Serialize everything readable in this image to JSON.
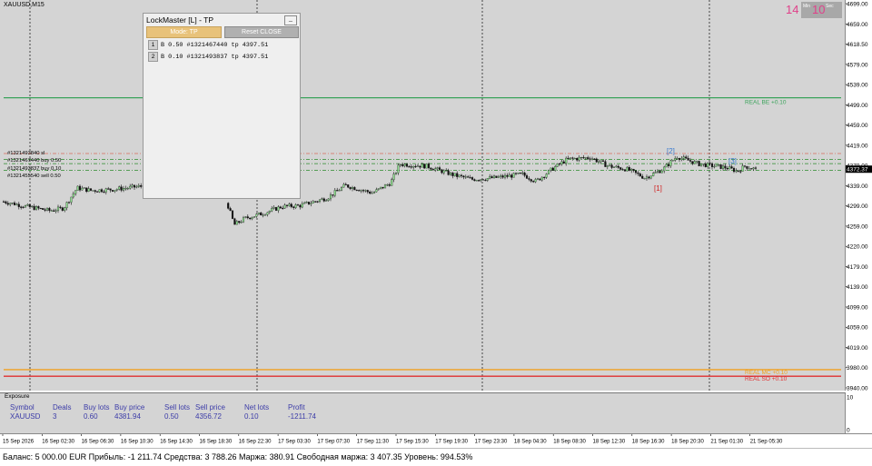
{
  "chart": {
    "symbol_label": "XAUUSD,M15",
    "price_labels": [
      "4699.00",
      "4659.00",
      "4618.50",
      "4579.00",
      "4539.00",
      "4499.00",
      "4459.00",
      "4419.00",
      "4379.00",
      "4339.00",
      "4299.00",
      "4259.00",
      "4220.00",
      "4179.00",
      "4139.00",
      "4099.00",
      "4059.00",
      "4019.00",
      "3980.00",
      "3940.00"
    ],
    "current_price": "4372.37",
    "sub_scale_labels": [
      "10",
      "0"
    ],
    "time_labels": [
      "15 Sep 2026",
      "16 Sep 02:30",
      "16 Sep 06:30",
      "16 Sep 10:30",
      "16 Sep 14:30",
      "16 Sep 18:30",
      "16 Sep 22:30",
      "17 Sep 03:30",
      "17 Sep 07:30",
      "17 Sep 11:30",
      "17 Sep 15:30",
      "17 Sep 19:30",
      "17 Sep 23:30",
      "18 Sep 04:30",
      "18 Sep 08:30",
      "18 Sep 12:30",
      "18 Sep 16:30",
      "18 Sep 20:30",
      "21 Sep 01:30",
      "21 Sep 05:30"
    ],
    "levels": [
      {
        "label": "REAL BE +0.10",
        "price": 4513,
        "color": "#3aa35a"
      },
      {
        "label": "REAL MC +0.10",
        "price": 3976,
        "color": "#f0a020"
      },
      {
        "label": "REAL SO +0.10",
        "price": 3963,
        "color": "#e03030"
      }
    ],
    "order_labels": [
      "#1321493840 sl",
      "#1321467440 buy 0.50",
      "#1321493837 buy 0.10",
      "#1321455540 sell 0.50"
    ],
    "markers": [
      "[1]",
      "[2]",
      "[3]"
    ],
    "colors": {
      "chart_bg": "#d4d4d4",
      "up_candle": "#8fe08f",
      "down_candle": "#111111",
      "accent_pink": "#e0408a"
    }
  },
  "timer": {
    "min_value": "14",
    "sec_value": "10",
    "min_label": "Min",
    "sec_label": "Sec"
  },
  "lockmaster": {
    "title": "LockMaster [L] - TP",
    "minimize_label": "_",
    "mode_button": "Mode: TP",
    "reset_button": "Reset CLOSE",
    "rows": [
      {
        "index": "1",
        "text": "B 0.50 #1321467440 tp 4397.51"
      },
      {
        "index": "2",
        "text": "B 0.10 #1321493837 tp 4397.51"
      }
    ]
  },
  "exposure": {
    "title": "Exposure",
    "headers": [
      "Symbol",
      "Deals",
      "Buy lots",
      "Buy price",
      "Sell lots",
      "Sell price",
      "Net lots",
      "Profit"
    ],
    "values": [
      "XAUUSD",
      "3",
      "0.60",
      "4381.94",
      "0.50",
      "4356.72",
      "0.10",
      "-1211.74"
    ]
  },
  "status_bar": {
    "text": "Баланс: 5 000.00 EUR  Прибыль: -1 211.74  Средства: 3 788.26  Маржа: 380.91  Свободная маржа: 3 407.35  Уровень: 994.53%"
  }
}
